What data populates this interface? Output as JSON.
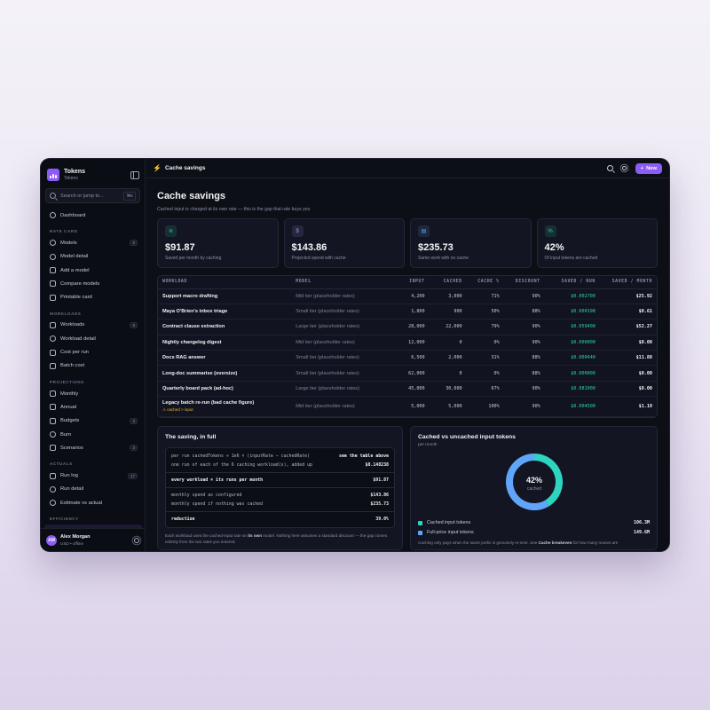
{
  "brand": {
    "name": "Tokens",
    "sub": "Tokens"
  },
  "search": {
    "placeholder": "Search or jump to...",
    "shortcut": "⌘K"
  },
  "nav": {
    "dashboard": "Dashboard",
    "sections": [
      {
        "title": "RATE CARD",
        "items": [
          {
            "label": "Models",
            "icon": "coin-icon",
            "badge": "5"
          },
          {
            "label": "Model detail",
            "icon": "eye-icon",
            "badge": ""
          },
          {
            "label": "Add a model",
            "icon": "plus-icon",
            "badge": ""
          },
          {
            "label": "Compare models",
            "icon": "scale-icon",
            "badge": ""
          },
          {
            "label": "Printable card",
            "icon": "document-icon",
            "badge": ""
          }
        ]
      },
      {
        "title": "WORKLOADS",
        "items": [
          {
            "label": "Workloads",
            "icon": "layers-icon",
            "badge": "8"
          },
          {
            "label": "Workload detail",
            "icon": "eye-icon",
            "badge": ""
          },
          {
            "label": "Cost per run",
            "icon": "receipt-icon",
            "badge": ""
          },
          {
            "label": "Batch cost",
            "icon": "stack-icon",
            "badge": ""
          }
        ]
      },
      {
        "title": "PROJECTIONS",
        "items": [
          {
            "label": "Monthly",
            "icon": "calendar-icon",
            "badge": ""
          },
          {
            "label": "Annual",
            "icon": "trend-icon",
            "badge": ""
          },
          {
            "label": "Budgets",
            "icon": "wallet-icon",
            "badge": "3"
          },
          {
            "label": "Burn",
            "icon": "flame-icon",
            "badge": ""
          },
          {
            "label": "Scenarios",
            "icon": "sliders-icon",
            "badge": "3"
          }
        ]
      },
      {
        "title": "ACTUALS",
        "items": [
          {
            "label": "Run log",
            "icon": "log-icon",
            "badge": "17"
          },
          {
            "label": "Run detail",
            "icon": "search-icon",
            "badge": ""
          },
          {
            "label": "Estimate vs actual",
            "icon": "pulse-icon",
            "badge": ""
          }
        ]
      },
      {
        "title": "EFFICIENCY",
        "items": []
      }
    ]
  },
  "user": {
    "initials": "AM",
    "name": "Alex Morgan",
    "sub": "USD • offline"
  },
  "topbar": {
    "title": "Cache savings",
    "new_label": "New"
  },
  "page": {
    "title": "Cache savings",
    "subtitle": "Cached input is charged at its own rate — this is the gap that rate buys you"
  },
  "cards": [
    {
      "value": "$91.87",
      "label": "Saved per month by caching",
      "icon": "layers-icon",
      "color": "#2dd4a7"
    },
    {
      "value": "$143.86",
      "label": "Projected spend with cache",
      "icon": "coin-icon",
      "color": "#a78bfa"
    },
    {
      "value": "$235.73",
      "label": "Same work with no cache",
      "icon": "calculator-icon",
      "color": "#60a5fa"
    },
    {
      "value": "42%",
      "label": "Of input tokens are cached",
      "icon": "percent-icon",
      "color": "#2dd4a7"
    }
  ],
  "table": {
    "headers": [
      "WORKLOAD",
      "MODEL",
      "INPUT",
      "CACHED",
      "CACHE %",
      "DISCOUNT",
      "SAVED / RUN",
      "SAVED / MONTH"
    ],
    "rows": [
      {
        "workload": "Support macro drafting",
        "model": "Mid tier (placeholder rates)",
        "input": "4,200",
        "cached": "3,000",
        "pct": "71%",
        "discount": "90%",
        "run": "$0.002700",
        "month": "$25.92",
        "note": ""
      },
      {
        "workload": "Maya O'Brien's inbox triage",
        "model": "Small tier (placeholder rates)",
        "input": "1,800",
        "cached": "900",
        "pct": "50%",
        "discount": "88%",
        "run": "$0.000198",
        "month": "$0.61",
        "note": ""
      },
      {
        "workload": "Contract clause extraction",
        "model": "Large tier (placeholder rates)",
        "input": "28,000",
        "cached": "22,000",
        "pct": "79%",
        "discount": "90%",
        "run": "$0.059400",
        "month": "$52.27",
        "note": ""
      },
      {
        "workload": "Nightly changelog digest",
        "model": "Mid tier (placeholder rates)",
        "input": "12,000",
        "cached": "0",
        "pct": "0%",
        "discount": "90%",
        "run": "$0.000000",
        "month": "$0.00",
        "note": ""
      },
      {
        "workload": "Docs RAG answer",
        "model": "Small tier (placeholder rates)",
        "input": "6,500",
        "cached": "2,000",
        "pct": "31%",
        "discount": "88%",
        "run": "$0.000440",
        "month": "$11.88",
        "note": ""
      },
      {
        "workload": "Long-doc summarise (oversize)",
        "model": "Small tier (placeholder rates)",
        "input": "62,000",
        "cached": "0",
        "pct": "0%",
        "discount": "88%",
        "run": "$0.000000",
        "month": "$0.00",
        "note": ""
      },
      {
        "workload": "Quarterly board pack (ad-hoc)",
        "model": "Large tier (placeholder rates)",
        "input": "45,000",
        "cached": "30,000",
        "pct": "67%",
        "discount": "90%",
        "run": "$0.081000",
        "month": "$0.00",
        "note": ""
      },
      {
        "workload": "Legacy batch re-run (bad cache figure)",
        "model": "Mid tier (placeholder rates)",
        "input": "5,000",
        "cached": "5,000",
        "pct": "100%",
        "discount": "90%",
        "run": "$0.004500",
        "month": "$1.19",
        "note": "⚠ cached > input"
      }
    ]
  },
  "saving_panel": {
    "title": "The saving, in full",
    "lines": [
      {
        "label": "per run cachedTokens ÷ 1e6 × (inputRate − cachedRate)",
        "value": "see the table above"
      },
      {
        "label": "one run of each of the 6 caching workload(s), added up",
        "value": "$0.148238"
      },
      {
        "label": "every workload × its runs per month",
        "value": "$91.87"
      },
      {
        "label": "monthly spend as configured",
        "value": "$143.86"
      },
      {
        "label": "monthly spend if nothing was cached",
        "value": "$235.73"
      },
      {
        "label": "reduction",
        "value": "39.0%"
      }
    ],
    "note_a": "Each workload uses the cached-input rate on ",
    "note_b": "its own",
    "note_c": " model. Nothing here assumes a standard discount — the gap comes entirely from the two rates you entered."
  },
  "donut_panel": {
    "title": "Cached vs uncached input tokens",
    "subtitle": "per month",
    "center_value": "42%",
    "center_label": "cached",
    "legend": [
      {
        "label": "Cached input tokens",
        "value": "106.3M",
        "color": "#2dd4bf"
      },
      {
        "label": "Full-price input tokens",
        "value": "149.6M",
        "color": "#60a5fa"
      }
    ],
    "note_a": "Caching only pays when the same prefix is genuinely re-sent. See ",
    "note_b": "Cache breakeven",
    "note_c": " for how many reuses are"
  },
  "chart_data": {
    "type": "pie",
    "categories": [
      "Cached input tokens",
      "Full-price input tokens"
    ],
    "values": [
      106.3,
      149.6
    ],
    "unit": "M",
    "title": "Cached vs uncached input tokens",
    "center_value": "42%"
  }
}
